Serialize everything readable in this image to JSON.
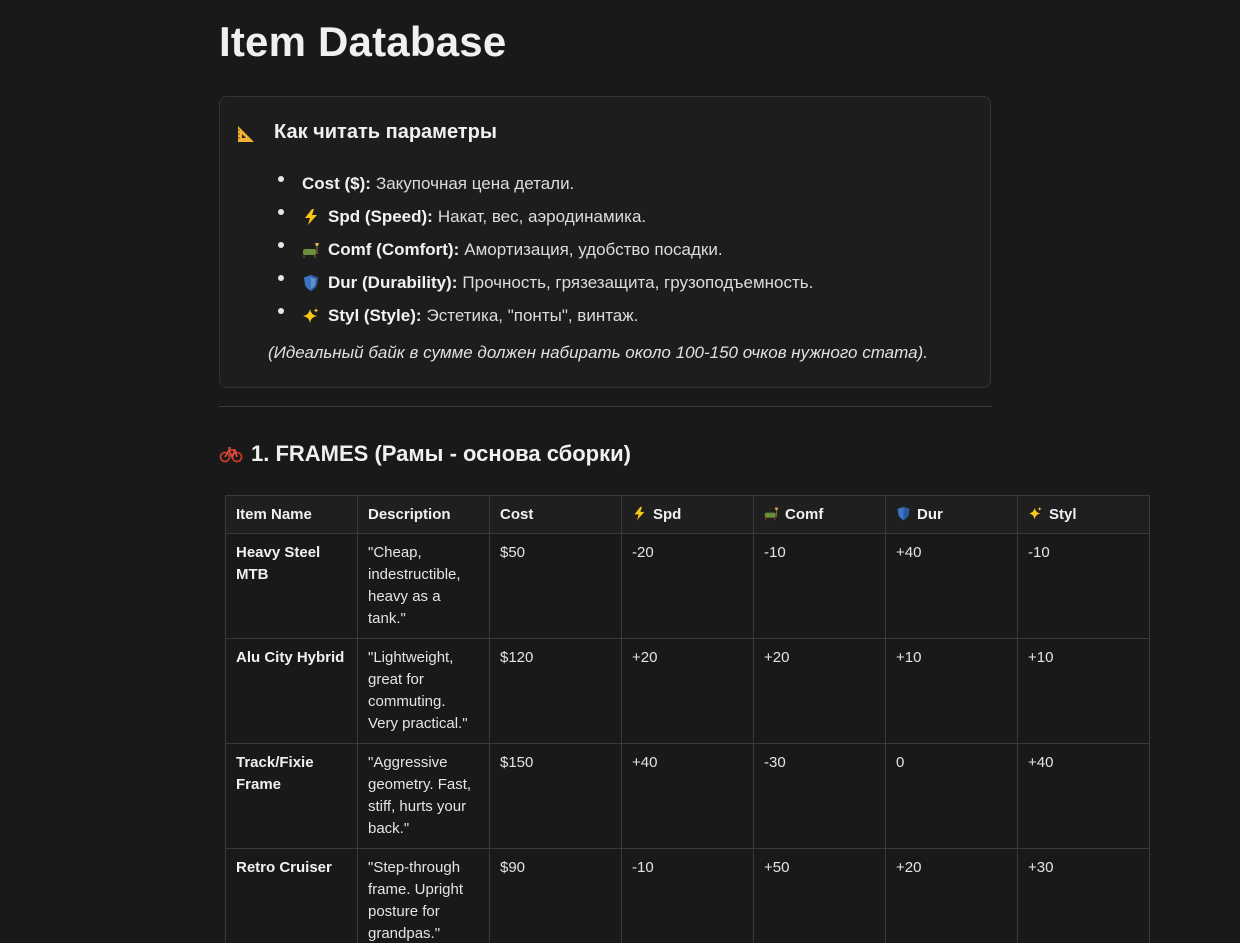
{
  "page": {
    "title": "Item Database"
  },
  "callout": {
    "icon": "triangular-ruler-icon",
    "title": "Как читать параметры",
    "items": [
      {
        "icon": null,
        "label": "Cost ($):",
        "text": "Закупочная цена детали."
      },
      {
        "icon": "lightning-icon",
        "label": "Spd (Speed):",
        "text": "Накат, вес, аэродинамика."
      },
      {
        "icon": "couch-lamp-icon",
        "label": "Comf (Comfort):",
        "text": "Амортизация, удобство посадки."
      },
      {
        "icon": "shield-icon",
        "label": "Dur (Durability):",
        "text": "Прочность, грязезащита, грузоподъемность."
      },
      {
        "icon": "sparkles-icon",
        "label": "Styl (Style):",
        "text": "Эстетика, \"понты\", винтаж."
      }
    ],
    "note": "(Идеальный байк в сумме должен набирать около 100-150 очков нужного стата)."
  },
  "section": {
    "icon": "bicycle-icon",
    "title": "1. FRAMES (Рамы - основа сборки)"
  },
  "table": {
    "headers": [
      {
        "label": "Item Name",
        "icon": null
      },
      {
        "label": "Description",
        "icon": null
      },
      {
        "label": "Cost",
        "icon": null
      },
      {
        "label": "Spd",
        "icon": "lightning-icon"
      },
      {
        "label": "Comf",
        "icon": "couch-lamp-icon"
      },
      {
        "label": "Dur",
        "icon": "shield-icon"
      },
      {
        "label": "Styl",
        "icon": "sparkles-icon"
      }
    ],
    "rows": [
      {
        "name": "Heavy Steel MTB",
        "description": "\"Cheap, indestructible, heavy as a tank.\"",
        "cost": "$50",
        "spd": "-20",
        "comf": "-10",
        "dur": "+40",
        "styl": "-10"
      },
      {
        "name": "Alu City Hybrid",
        "description": "\"Lightweight, great for commuting. Very practical.\"",
        "cost": "$120",
        "spd": "+20",
        "comf": "+20",
        "dur": "+10",
        "styl": "+10"
      },
      {
        "name": "Track/Fixie Frame",
        "description": "\"Aggressive geometry. Fast, stiff, hurts your back.\"",
        "cost": "$150",
        "spd": "+40",
        "comf": "-30",
        "dur": "0",
        "styl": "+40"
      },
      {
        "name": "Retro Cruiser",
        "description": "\"Step-through frame. Upright posture for grandpas.\"",
        "cost": "$90",
        "spd": "-10",
        "comf": "+50",
        "dur": "+20",
        "styl": "+30"
      }
    ]
  }
}
